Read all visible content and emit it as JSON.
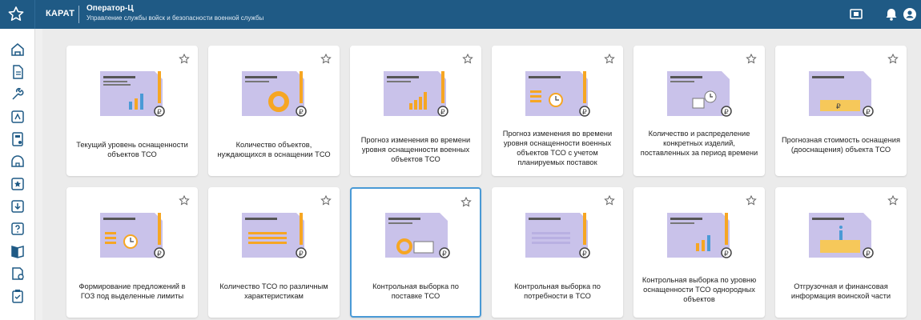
{
  "header": {
    "brand": "КАРАТ",
    "app_title": "Оператор-Ц",
    "app_subtitle": "Управление службы войск и безопасности военной службы",
    "icons": [
      "star-icon",
      "monitor-icon",
      "bell-icon",
      "user-icon"
    ]
  },
  "sidebar": {
    "icons": [
      "home-icon",
      "document-icon",
      "wrench-icon",
      "map-icon",
      "calculator-icon",
      "dome-icon",
      "star-box-icon",
      "download-icon",
      "help-icon",
      "book-icon",
      "report-icon",
      "clipboard-icon"
    ]
  },
  "colors": {
    "header_bg": "#1f5a85",
    "accent": "#4a9ad6",
    "illus_purple": "#c9c2ea",
    "illus_orange": "#f6a623"
  },
  "cards": [
    {
      "label": "Текущий уровень оснащенности объектов ТСО",
      "illus": "bar-chart-icon"
    },
    {
      "label": "Количество объектов, нуждающихся в оснащении ТСО",
      "illus": "donut-chart-icon"
    },
    {
      "label": "Прогноз изменения во времени уровня оснащенности военных объектов ТСО",
      "illus": "growth-chart-icon"
    },
    {
      "label": "Прогноз изменения во времени уровня оснащенности военных объектов ТСО с учетом планируемых поставок",
      "illus": "clock-doc-icon"
    },
    {
      "label": "Количество и распределение конкретных изделий, поставленных за период времени",
      "illus": "box-clock-icon"
    },
    {
      "label": "Прогнозная стоимость оснащения (дооснащения) объекта ТСО",
      "illus": "money-scroll-icon"
    },
    {
      "label": "Формирование предложений в ГОЗ под выделенные лимиты",
      "illus": "clock-doc-icon"
    },
    {
      "label": "Количество ТСО по различным характеристикам",
      "illus": "table-doc-icon"
    },
    {
      "label": "Контрольная выборка по поставке ТСО",
      "illus": "delivery-icon"
    },
    {
      "label": "Контрольная выборка по потребности в ТСО",
      "illus": "table-doc-icon"
    },
    {
      "label": "Контрольная выборка по уровню оснащенности ТСО однородных объектов",
      "illus": "bar-chart-icon"
    },
    {
      "label": "Отгрузочная и финансовая информация воинской части",
      "illus": "info-scroll-icon"
    }
  ]
}
